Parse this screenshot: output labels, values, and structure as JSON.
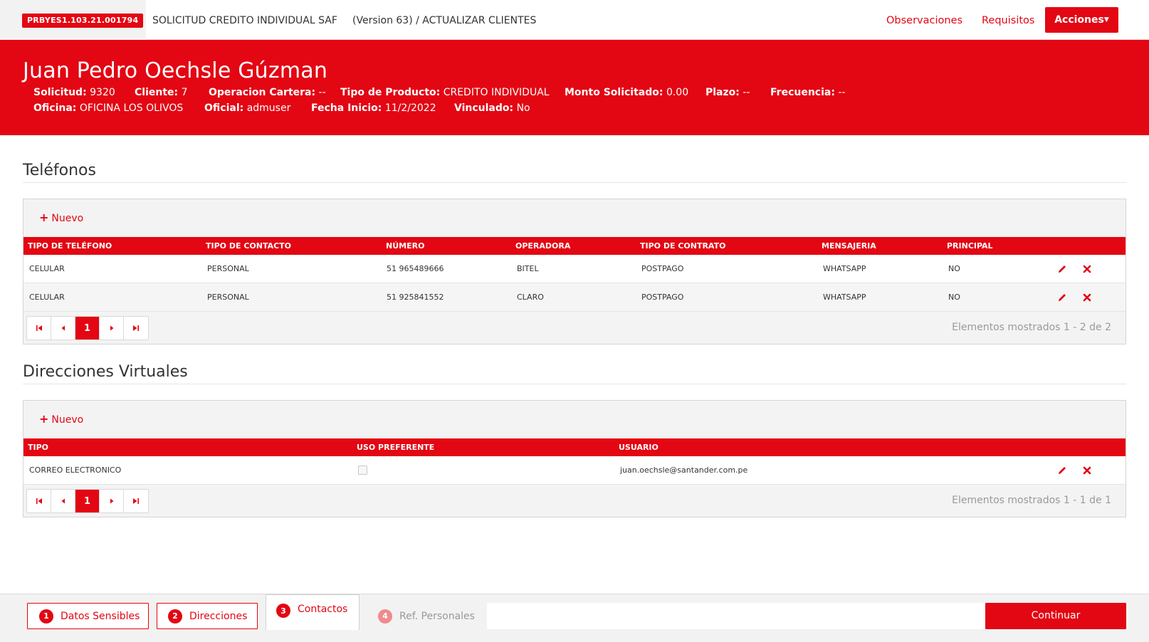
{
  "topbar": {
    "code": "PRBYES1.103.21.001794",
    "title": "SOLICITUD CREDITO INDIVIDUAL SAF",
    "version": "(Version 63) / ACTUALIZAR CLIENTES",
    "observaciones": "Observaciones",
    "requisitos": "Requisitos",
    "acciones": "Acciones"
  },
  "client": {
    "name": "Juan Pedro Oechsle Gúzman",
    "fields": {
      "solicitud": {
        "label": "Solicitud:",
        "value": "9320"
      },
      "cliente": {
        "label": "Cliente:",
        "value": "7"
      },
      "operacion_cartera": {
        "label": "Operacion Cartera:",
        "value": "--"
      },
      "tipo_producto": {
        "label": "Tipo de Producto:",
        "value": "CREDITO INDIVIDUAL"
      },
      "monto_solicitado": {
        "label": "Monto Solicitado:",
        "value": "0.00"
      },
      "plazo": {
        "label": "Plazo:",
        "value": "--"
      },
      "frecuencia": {
        "label": "Frecuencia:",
        "value": "--"
      },
      "oficina": {
        "label": "Oficina:",
        "value": "OFICINA LOS OLIVOS"
      },
      "oficial": {
        "label": "Oficial:",
        "value": "admuser"
      },
      "fecha_inicio": {
        "label": "Fecha Inicio:",
        "value": "11/2/2022"
      },
      "vinculado": {
        "label": "Vinculado:",
        "value": "No"
      }
    }
  },
  "telefonos": {
    "title": "Teléfonos",
    "nuevo": "Nuevo",
    "columns": [
      "TIPO DE TELÉFONO",
      "TIPO DE CONTACTO",
      "NÚMERO",
      "OPERADORA",
      "TIPO DE CONTRATO",
      "MENSAJERIA",
      "PRINCIPAL"
    ],
    "rows": [
      [
        "CELULAR",
        "PERSONAL",
        "51 965489666",
        "BITEL",
        "POSTPAGO",
        "WHATSAPP",
        "NO"
      ],
      [
        "CELULAR",
        "PERSONAL",
        "51 925841552",
        "CLARO",
        "POSTPAGO",
        "WHATSAPP",
        "NO"
      ]
    ],
    "page": "1",
    "info": "Elementos mostrados 1 - 2 de 2"
  },
  "direcciones": {
    "title": "Direcciones Virtuales",
    "nuevo": "Nuevo",
    "columns": [
      "TIPO",
      "USO PREFERENTE",
      "USUARIO"
    ],
    "rows": [
      {
        "tipo": "CORREO ELECTRONICO",
        "uso_preferente": false,
        "usuario": "juan.oechsle@santander.com.pe"
      }
    ],
    "page": "1",
    "info": "Elementos mostrados 1 - 1 de 1"
  },
  "wizard": {
    "steps": [
      {
        "num": "1",
        "label": "Datos Sensibles",
        "state": "done"
      },
      {
        "num": "2",
        "label": "Direcciones",
        "state": "done"
      },
      {
        "num": "3",
        "label": "Contactos",
        "state": "active"
      },
      {
        "num": "4",
        "label": "Ref. Personales",
        "state": "disabled"
      }
    ],
    "continuar": "Continuar"
  },
  "colors": {
    "brand": "#e30613",
    "muted": "#9a9a9a"
  },
  "icons": [
    "edit-pencil-icon",
    "delete-x-icon",
    "first-page-icon",
    "prev-page-icon",
    "next-page-icon",
    "last-page-icon"
  ]
}
